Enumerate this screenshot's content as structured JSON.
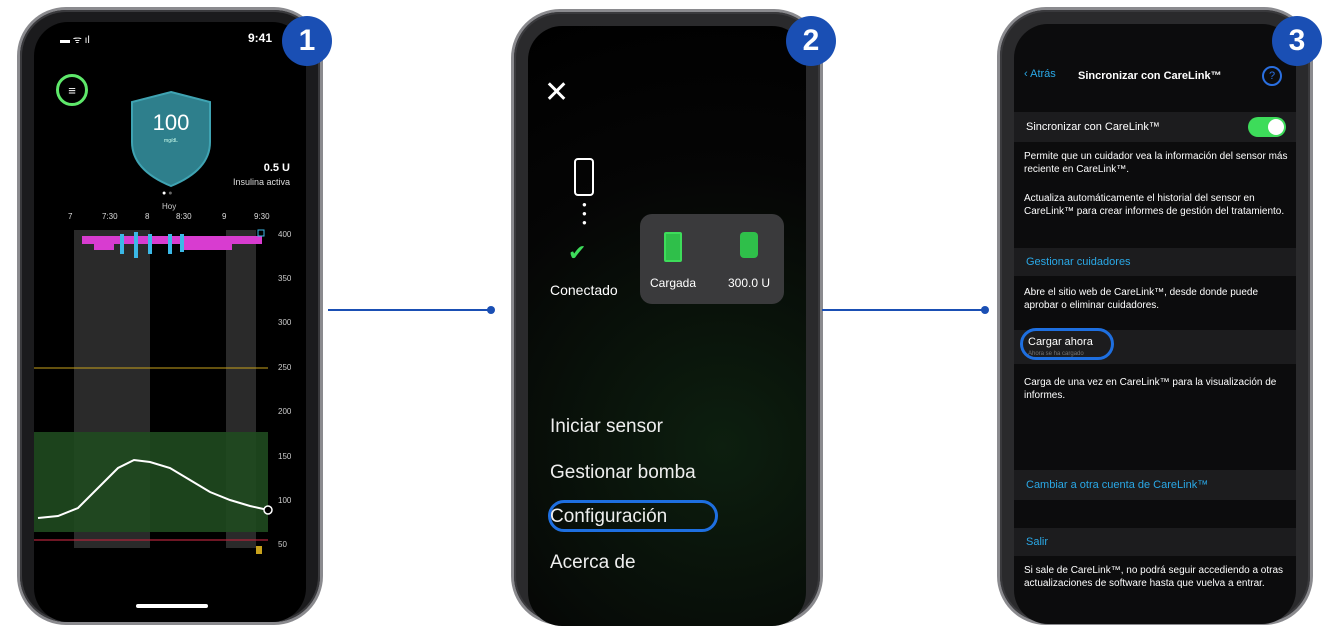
{
  "steps": [
    "1",
    "2",
    "3"
  ],
  "phone1": {
    "time": "9:41",
    "glucose_value": "100",
    "glucose_unit": "mg/dL",
    "insulin_value": "0.5 U",
    "insulin_label": "Insulina activa",
    "day_label": "Hoy",
    "x_ticks": [
      "7",
      "7:30",
      "8",
      "8:30",
      "9",
      "9:30"
    ],
    "y_ticks": [
      "400",
      "350",
      "300",
      "250",
      "200",
      "150",
      "100",
      "50"
    ]
  },
  "phone2": {
    "connected_label": "Conectado",
    "battery_label": "Cargada",
    "reservoir_label": "300.0 U",
    "menu": [
      "Iniciar sensor",
      "Gestionar bomba",
      "Configuración",
      "Acerca de"
    ]
  },
  "phone3": {
    "back_label": "Atrás",
    "title": "Sincronizar con CareLink™",
    "help": "?",
    "sync_label": "Sincronizar con CareLink™",
    "sync_desc": "Permite que un cuidador vea la información del sensor más reciente en CareLink™.",
    "auto_desc": "Actualiza automáticamente el historial del sensor en CareLink™ para crear informes de gestión del tratamiento.",
    "manage_label": "Gestionar cuidadores",
    "manage_desc": "Abre el sitio web de CareLink™, desde donde puede aprobar o eliminar cuidadores.",
    "upload_label": "Cargar ahora",
    "upload_sub": "Ahora se ha cargado",
    "upload_desc": "Carga de una vez en CareLink™ para la visualización de informes.",
    "switch_label": "Cambiar a otra cuenta de CareLink™",
    "exit_label": "Salir",
    "exit_desc": "Si sale de CareLink™, no podrá seguir accediendo a otras actualizaciones de software hasta que vuelva a entrar."
  },
  "colors": {
    "accent": "#1a4fb4",
    "green": "#3ddc5a",
    "link": "#2aa8e6",
    "magenta": "#e03cd6",
    "shield": "#2e8a96"
  }
}
